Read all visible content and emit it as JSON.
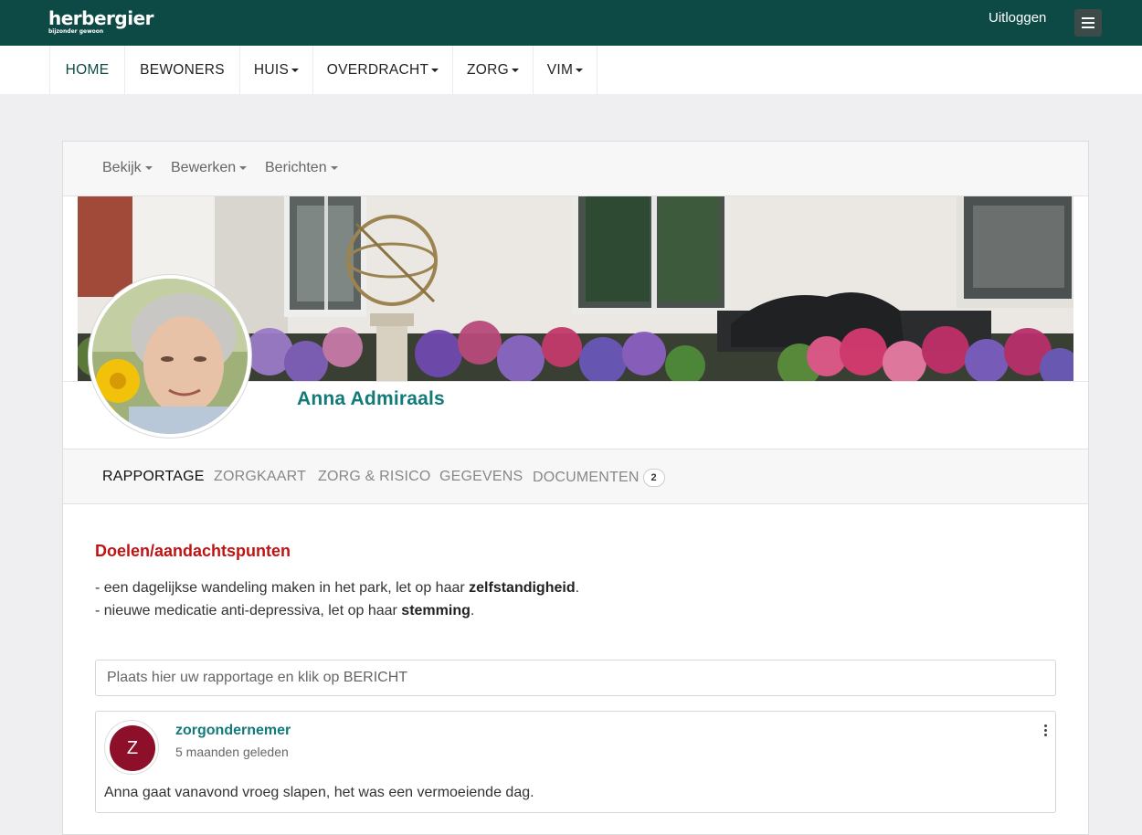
{
  "brand": {
    "name": "herbergier",
    "tagline": "bijzonder gewoon"
  },
  "topbar": {
    "logout_label": "Uitloggen",
    "menu_icon": "hamburger-icon"
  },
  "main_nav": [
    {
      "label": "HOME",
      "active": true,
      "dropdown": false
    },
    {
      "label": "BEWONERS",
      "active": false,
      "dropdown": false
    },
    {
      "label": "HUIS",
      "active": false,
      "dropdown": true
    },
    {
      "label": "OVERDRACHT",
      "active": false,
      "dropdown": true
    },
    {
      "label": "ZORG",
      "active": false,
      "dropdown": true
    },
    {
      "label": "VIM",
      "active": false,
      "dropdown": true
    }
  ],
  "sub_nav": [
    {
      "label": "Bekijk"
    },
    {
      "label": "Bewerken"
    },
    {
      "label": "Berichten"
    }
  ],
  "profile": {
    "name": "Anna Admiraals"
  },
  "tabs": [
    {
      "label": "RAPPORTAGE",
      "active": true
    },
    {
      "label": "ZORGKAART",
      "active": false
    },
    {
      "label": "ZORG & RISICO",
      "active": false
    },
    {
      "label": "GEGEVENS",
      "active": false
    },
    {
      "label": "DOCUMENTEN",
      "active": false,
      "badge": "2"
    }
  ],
  "goals": {
    "title": "Doelen/aandachtspunten",
    "items": [
      {
        "prefix": "- een dagelijkse wandeling maken in het park, let op haar ",
        "bold": "zelfstandigheid",
        "suffix": "."
      },
      {
        "prefix": "- nieuwe medicatie anti-depressiva, let op haar ",
        "bold": "stemming",
        "suffix": "."
      }
    ]
  },
  "compose": {
    "placeholder": "Plaats hier uw rapportage en klik op BERICHT"
  },
  "post": {
    "initial": "Z",
    "author": "zorgondernemer",
    "time": "5 maanden geleden",
    "body": "Anna gaat vanavond vroeg slapen, het was een vermoeiende dag."
  },
  "colors": {
    "topbar": "#0e4a45",
    "accent": "#127a78",
    "goals_title": "#c01414",
    "post_avatar": "#8e0f2a"
  }
}
